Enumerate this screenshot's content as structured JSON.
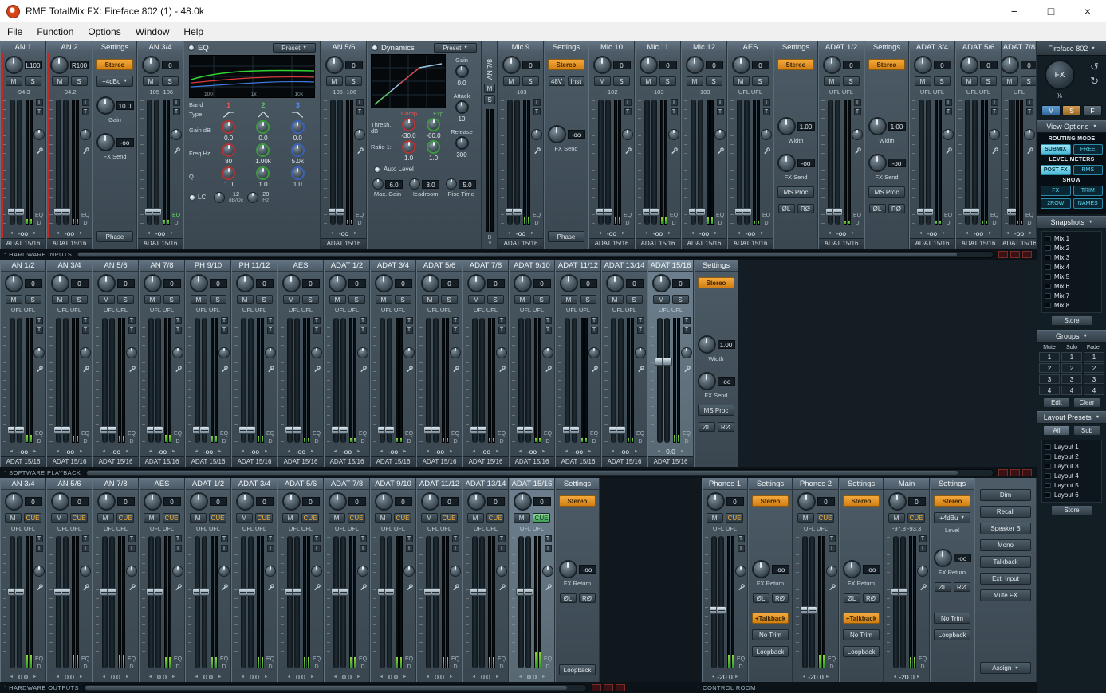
{
  "window": {
    "title": "RME TotalMix FX: Fireface 802 (1) - 48.0k",
    "menus": [
      "File",
      "Function",
      "Options",
      "Window",
      "Help"
    ]
  },
  "glyphs": {
    "down": "▼",
    "left": "◄",
    "right": "►",
    "undo": "↺",
    "redo": "↻",
    "bullet": "▪",
    "minimize": "−",
    "maximize": "□",
    "close": "×"
  },
  "labels": {
    "settings": "Settings",
    "stereo": "Stereo",
    "mute": "M",
    "solo": "S",
    "cue": "CUE",
    "eq": "EQ",
    "dyn": "D",
    "trim_tool": "T",
    "gain": "Gain",
    "fx_send": "FX Send",
    "fx_return": "FX Return",
    "width": "Width",
    "ms_proc": "MS Proc",
    "phase": "Phase",
    "phase_left": "ØL",
    "phase_right": "RØ",
    "phantom": "48V",
    "inst": "Inst",
    "no_trim": "No Trim",
    "loopback": "Loopback",
    "talkback_on": "+Talkback",
    "level": "Level",
    "ref_level": "+4dBu"
  },
  "bars": {
    "hardware_inputs": "HARDWARE INPUTS",
    "software_playback": "SOFTWARE PLAYBACK",
    "hardware_outputs": "HARDWARE OUTPUTS",
    "control_room": "CONTROL ROOM"
  },
  "settings_panels": {
    "an": {
      "gain": "10.0",
      "fx": "-oo"
    },
    "mic": {
      "fx": "-oo"
    },
    "width": {
      "width": "1.00",
      "fx": "-oo"
    },
    "play": {
      "fx": "-oo"
    },
    "phones": {
      "fx": "-oo"
    },
    "main": {
      "fx": "-oo"
    }
  },
  "eq_panel": {
    "title": "EQ",
    "preset": "Preset",
    "freq_ticks": [
      "100",
      "1k",
      "10k"
    ],
    "band_label": "Band",
    "bands": [
      "1",
      "2",
      "3"
    ],
    "type_label": "Type",
    "gain_label": "Gain dB",
    "gains": [
      "0.0",
      "0.0",
      "0.0"
    ],
    "freq_label": "Freq Hz",
    "freqs": [
      "80",
      "1.00k",
      "5.0k"
    ],
    "q_label": "Q",
    "qs": [
      "1.0",
      "1.0",
      "1.0"
    ],
    "lc_label": "LC",
    "lc_slope": "12",
    "lc_slope_unit": "dB/Oc",
    "lc_freq": "20",
    "lc_freq_unit": "Hz"
  },
  "dyn_panel": {
    "title": "Dynamics",
    "preset": "Preset",
    "gain_label": "Gain",
    "gain": "0.0",
    "attack_label": "Attack",
    "attack": "10",
    "release_label": "Release",
    "release": "300",
    "thresh_label": "Thresh. dB",
    "comp_label": "Comp.",
    "exp_label": "Exp.",
    "thresh_comp": "-30.0",
    "thresh_exp": "-60.0",
    "ratio_label": "Ratio 1:",
    "ratio_comp": "1.0",
    "ratio_exp": "1.0",
    "auto_level": "Auto Level",
    "max_gain_label": "Max. Gain",
    "max_gain": "6.0",
    "headroom_label": "Headroom",
    "headroom": "8.0",
    "rise_time_label": "Rise Time",
    "rise_time": "5.0"
  },
  "monitor": {
    "buttons": [
      "Dim",
      "Recall",
      "Speaker B",
      "Mono",
      "Talkback",
      "Ext. Input",
      "Mute FX"
    ],
    "assign": "Assign"
  },
  "top_row": [
    {
      "kind": "ch",
      "name": "AN 1",
      "pan": "L100",
      "level": "-94.3",
      "bottom": "-oo",
      "route": "ADAT 15/16",
      "armed": true,
      "handle": 0.9,
      "meter": 0.04
    },
    {
      "kind": "ch",
      "name": "AN 2",
      "pan": "R100",
      "level": "-94.2",
      "bottom": "-oo",
      "route": "ADAT 15/16",
      "armed": true,
      "handle": 0.9,
      "meter": 0.04
    },
    {
      "kind": "set",
      "variant": "an"
    },
    {
      "kind": "ch",
      "name": "AN 3/4",
      "pan": "0",
      "level": "-105 -106",
      "bottom": "-oo",
      "route": "ADAT 15/16",
      "eq_on": true,
      "handle": 0.9,
      "meter": 0.03
    },
    {
      "kind": "eq"
    },
    {
      "kind": "ch",
      "name": "AN 5/6",
      "pan": "0",
      "level": "-105 -106",
      "bottom": "-oo",
      "route": "ADAT 15/16",
      "handle": 0.9,
      "meter": 0.03
    },
    {
      "kind": "dyn"
    },
    {
      "kind": "vert",
      "name": "AN 7/8"
    },
    {
      "kind": "ch",
      "name": "Mic 9",
      "pan": "0",
      "level": "-103",
      "bottom": "-oo",
      "route": "ADAT 15/16",
      "handle": 0.9,
      "meter": 0.05
    },
    {
      "kind": "set",
      "variant": "mic"
    },
    {
      "kind": "ch",
      "name": "Mic 10",
      "pan": "0",
      "level": "-102",
      "bottom": "-oo",
      "route": "ADAT 15/16",
      "handle": 0.9,
      "meter": 0.05
    },
    {
      "kind": "ch",
      "name": "Mic 11",
      "pan": "0",
      "level": "-103",
      "bottom": "-oo",
      "route": "ADAT 15/16",
      "handle": 0.9,
      "meter": 0.05
    },
    {
      "kind": "ch",
      "name": "Mic 12",
      "pan": "0",
      "level": "-103",
      "bottom": "-oo",
      "route": "ADAT 15/16",
      "handle": 0.9,
      "meter": 0.05
    },
    {
      "kind": "ch",
      "name": "AES",
      "pan": "0",
      "level": "UFL UFL",
      "bottom": "-oo",
      "route": "ADAT 15/16",
      "handle": 0.9,
      "meter": 0.02
    },
    {
      "kind": "set",
      "variant": "width"
    },
    {
      "kind": "ch",
      "name": "ADAT 1/2",
      "pan": "0",
      "level": "UFL UFL",
      "bottom": "-oo",
      "route": "ADAT 15/16",
      "handle": 0.9,
      "meter": 0.02
    },
    {
      "kind": "set",
      "variant": "width"
    },
    {
      "kind": "ch",
      "name": "ADAT 3/4",
      "pan": "0",
      "level": "UFL UFL",
      "bottom": "-oo",
      "route": "ADAT 15/16",
      "handle": 0.9,
      "meter": 0.02
    },
    {
      "kind": "ch",
      "name": "ADAT 5/6",
      "pan": "0",
      "level": "UFL UFL",
      "bottom": "-oo",
      "route": "ADAT 15/16",
      "handle": 0.9,
      "meter": 0.02
    },
    {
      "kind": "ch",
      "name": "ADAT 7/8",
      "pan": "0",
      "level": "UFL",
      "bottom": "-oo",
      "route": "ADAT 15/16",
      "handle": 0.9,
      "meter": 0.02,
      "partial": true
    }
  ],
  "mid_row": [
    {
      "kind": "ch",
      "name": "AN 1/2",
      "pan": "0",
      "level": "UFL UFL",
      "bottom": "-oo",
      "route": "ADAT 15/16",
      "handle": 0.9,
      "meter": 0.06
    },
    {
      "kind": "ch",
      "name": "AN 3/4",
      "pan": "0",
      "level": "UFL UFL",
      "bottom": "-oo",
      "route": "ADAT 15/16",
      "handle": 0.9,
      "meter": 0.05
    },
    {
      "kind": "ch",
      "name": "AN 5/6",
      "pan": "0",
      "level": "UFL UFL",
      "bottom": "-oo",
      "route": "ADAT 15/16",
      "handle": 0.9,
      "meter": 0.05
    },
    {
      "kind": "ch",
      "name": "AN 7/8",
      "pan": "0",
      "level": "UFL UFL",
      "bottom": "-oo",
      "route": "ADAT 15/16",
      "handle": 0.9,
      "meter": 0.06
    },
    {
      "kind": "ch",
      "name": "PH 9/10",
      "pan": "0",
      "level": "UFL UFL",
      "bottom": "-oo",
      "route": "ADAT 15/16",
      "handle": 0.9,
      "meter": 0.05
    },
    {
      "kind": "ch",
      "name": "PH 11/12",
      "pan": "0",
      "level": "UFL UFL",
      "bottom": "-oo",
      "route": "ADAT 15/16",
      "handle": 0.9,
      "meter": 0.05
    },
    {
      "kind": "ch",
      "name": "AES",
      "pan": "0",
      "level": "UFL UFL",
      "bottom": "-oo",
      "route": "ADAT 15/16",
      "handle": 0.9,
      "meter": 0.03
    },
    {
      "kind": "ch",
      "name": "ADAT 1/2",
      "pan": "0",
      "level": "UFL UFL",
      "bottom": "-oo",
      "route": "ADAT 15/16",
      "handle": 0.9,
      "meter": 0.03
    },
    {
      "kind": "ch",
      "name": "ADAT 3/4",
      "pan": "0",
      "level": "UFL UFL",
      "bottom": "-oo",
      "route": "ADAT 15/16",
      "handle": 0.9,
      "meter": 0.03
    },
    {
      "kind": "ch",
      "name": "ADAT 5/6",
      "pan": "0",
      "level": "UFL UFL",
      "bottom": "-oo",
      "route": "ADAT 15/16",
      "handle": 0.9,
      "meter": 0.03
    },
    {
      "kind": "ch",
      "name": "ADAT 7/8",
      "pan": "0",
      "level": "UFL UFL",
      "bottom": "-oo",
      "route": "ADAT 15/16",
      "handle": 0.9,
      "meter": 0.03
    },
    {
      "kind": "ch",
      "name": "ADAT 9/10",
      "pan": "0",
      "level": "UFL UFL",
      "bottom": "-oo",
      "route": "ADAT 15/16",
      "handle": 0.9,
      "meter": 0.03
    },
    {
      "kind": "ch",
      "name": "ADAT 11/12",
      "pan": "0",
      "level": "UFL UFL",
      "bottom": "-oo",
      "route": "ADAT 15/16",
      "handle": 0.9,
      "meter": 0.03
    },
    {
      "kind": "ch",
      "name": "ADAT 13/14",
      "pan": "0",
      "level": "UFL UFL",
      "bottom": "-oo",
      "route": "ADAT 15/16",
      "handle": 0.9,
      "meter": 0.03
    },
    {
      "kind": "ch",
      "name": "ADAT 15/16",
      "pan": "0",
      "level": "UFL UFL",
      "bottom": "0.0",
      "route": "ADAT 15/16",
      "selected": true,
      "handle": 0.35,
      "meter": 0.06
    },
    {
      "kind": "set",
      "variant": "width"
    }
  ],
  "bot_row": [
    {
      "kind": "ch",
      "name": "AN 3/4",
      "pan": "0",
      "cue": true,
      "level": "UFL UFL",
      "bottom": "0.0",
      "handle": 0.42,
      "meter": 0.1
    },
    {
      "kind": "ch",
      "name": "AN 5/6",
      "pan": "0",
      "cue": true,
      "level": "UFL UFL",
      "bottom": "0.0",
      "handle": 0.42,
      "meter": 0.1
    },
    {
      "kind": "ch",
      "name": "AN 7/8",
      "pan": "0",
      "cue": true,
      "level": "UFL UFL",
      "bottom": "0.0",
      "handle": 0.42,
      "meter": 0.1
    },
    {
      "kind": "ch",
      "name": "AES",
      "pan": "0",
      "cue": true,
      "level": "UFL UFL",
      "bottom": "0.0",
      "handle": 0.42,
      "meter": 0.08
    },
    {
      "kind": "ch",
      "name": "ADAT 1/2",
      "pan": "0",
      "cue": true,
      "level": "UFL UFL",
      "bottom": "0.0",
      "handle": 0.42,
      "meter": 0.08
    },
    {
      "kind": "ch",
      "name": "ADAT 3/4",
      "pan": "0",
      "cue": true,
      "level": "UFL UFL",
      "bottom": "0.0",
      "handle": 0.42,
      "meter": 0.08
    },
    {
      "kind": "ch",
      "name": "ADAT 5/6",
      "pan": "0",
      "cue": true,
      "level": "UFL UFL",
      "bottom": "0.0",
      "handle": 0.42,
      "meter": 0.08
    },
    {
      "kind": "ch",
      "name": "ADAT 7/8",
      "pan": "0",
      "cue": true,
      "level": "UFL UFL",
      "bottom": "0.0",
      "handle": 0.42,
      "meter": 0.08
    },
    {
      "kind": "ch",
      "name": "ADAT 9/10",
      "pan": "0",
      "cue": true,
      "level": "UFL UFL",
      "bottom": "0.0",
      "handle": 0.42,
      "meter": 0.08
    },
    {
      "kind": "ch",
      "name": "ADAT 11/12",
      "pan": "0",
      "cue": true,
      "level": "UFL UFL",
      "bottom": "0.0",
      "handle": 0.42,
      "meter": 0.08
    },
    {
      "kind": "ch",
      "name": "ADAT 13/14",
      "pan": "0",
      "cue": true,
      "level": "UFL UFL",
      "bottom": "0.0",
      "handle": 0.42,
      "meter": 0.08
    },
    {
      "kind": "ch",
      "name": "ADAT 15/16",
      "pan": "0",
      "cue": true,
      "cue_on": true,
      "level": "UFL UFL",
      "bottom": "0.0",
      "selected": true,
      "handle": 0.42,
      "meter": 0.12
    },
    {
      "kind": "set",
      "variant": "play"
    }
  ],
  "control_room": [
    {
      "kind": "ch",
      "name": "Phones 1",
      "pan": "0",
      "cue": true,
      "level": "UFL UFL",
      "bottom": "-20.0",
      "handle": 0.56,
      "meter": 0.1
    },
    {
      "kind": "set",
      "variant": "phones"
    },
    {
      "kind": "ch",
      "name": "Phones 2",
      "pan": "0",
      "cue": true,
      "level": "UFL UFL",
      "bottom": "-20.0",
      "handle": 0.56,
      "meter": 0.1
    },
    {
      "kind": "set",
      "variant": "phones"
    },
    {
      "kind": "ch",
      "name": "Main",
      "pan": "0",
      "cue": true,
      "level": "-97.8 -93.3",
      "bottom": "-20.0",
      "handle": 0.42,
      "meter": 0.08
    },
    {
      "kind": "set",
      "variant": "main"
    },
    {
      "kind": "monitor"
    }
  ],
  "sidebar": {
    "device": "Fireface 802",
    "fx_label": "FX",
    "fx_unit": "%",
    "group_buttons": [
      "M",
      "S",
      "F"
    ],
    "view_options": {
      "title": "View Options",
      "routing_mode_label": "ROUTING MODE",
      "routing_modes": [
        "SUBMIX",
        "FREE"
      ],
      "routing_active": 0,
      "level_meters_label": "LEVEL METERS",
      "level_meter_modes": [
        "POST FX",
        "RMS"
      ],
      "level_active": 0,
      "show_label": "SHOW",
      "show_buttons": [
        "FX",
        "TRIM",
        "2ROW",
        "NAMES"
      ]
    },
    "snapshots": {
      "title": "Snapshots",
      "items": [
        "Mix 1",
        "Mix 2",
        "Mix 3",
        "Mix 4",
        "Mix 5",
        "Mix 6",
        "Mix 7",
        "Mix 8"
      ],
      "store": "Store"
    },
    "groups": {
      "title": "Groups",
      "headers": [
        "Mute",
        "Solo",
        "Fader"
      ],
      "rows": [
        [
          "1",
          "1",
          "1"
        ],
        [
          "2",
          "2",
          "2"
        ],
        [
          "3",
          "3",
          "3"
        ],
        [
          "4",
          "4",
          "4"
        ]
      ],
      "edit": "Edit",
      "clear": "Clear"
    },
    "layouts": {
      "title": "Layout Presets",
      "tabs": [
        "All",
        "Sub"
      ],
      "items": [
        "Layout 1",
        "Layout 2",
        "Layout 3",
        "Layout 4",
        "Layout 5",
        "Layout 6"
      ],
      "store": "Store"
    }
  }
}
